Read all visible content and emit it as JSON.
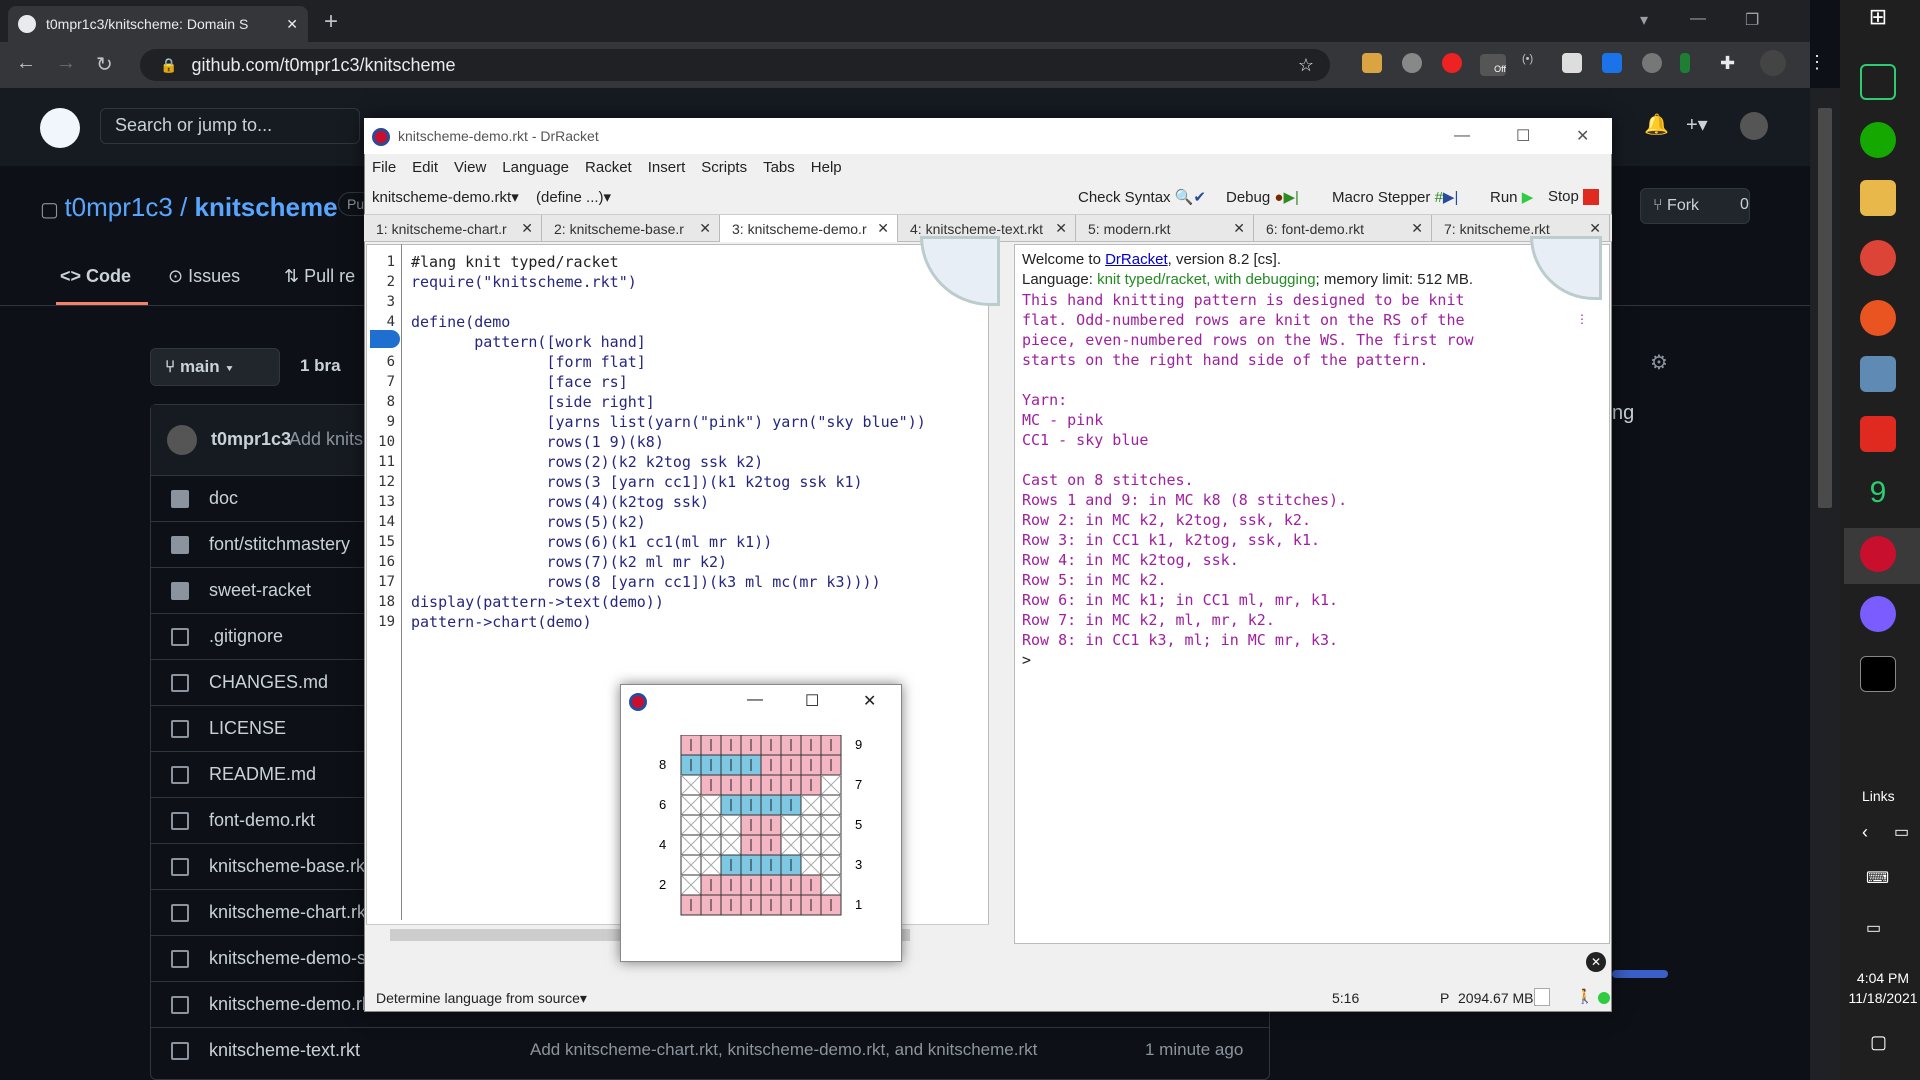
{
  "browser": {
    "tab_title": "t0mpr1c3/knitscheme: Domain S",
    "url": "github.com/t0mpr1c3/knitscheme",
    "ext_off_label": "Off"
  },
  "github": {
    "search_placeholder": "Search or jump to...",
    "owner": "t0mpr1c3",
    "repo": "knitscheme",
    "visibility": "Pu",
    "tabs": [
      "Code",
      "Issues",
      "Pull re"
    ],
    "branch": "main",
    "branches": "1 bra",
    "fork_label": "Fork",
    "fork_count": "0",
    "commit_user": "t0mpr1c3",
    "commit_msg": "Add knits",
    "side_text": "ng",
    "files": [
      {
        "name": "doc",
        "type": "dir"
      },
      {
        "name": "font/stitchmastery",
        "type": "dir"
      },
      {
        "name": "sweet-racket",
        "type": "submodule"
      },
      {
        "name": ".gitignore",
        "type": "file"
      },
      {
        "name": "CHANGES.md",
        "type": "file"
      },
      {
        "name": "LICENSE",
        "type": "file"
      },
      {
        "name": "README.md",
        "type": "file"
      },
      {
        "name": "font-demo.rkt",
        "type": "file"
      },
      {
        "name": "knitscheme-base.rkt",
        "type": "file"
      },
      {
        "name": "knitscheme-chart.rk",
        "type": "file"
      },
      {
        "name": "knitscheme-demo-s",
        "type": "file"
      },
      {
        "name": "knitscheme-demo.rk",
        "type": "file"
      },
      {
        "name": "knitscheme-text.rkt",
        "type": "file"
      }
    ],
    "last_commit_msg": "Add knitscheme-chart.rkt, knitscheme-demo.rkt, and knitscheme.rkt",
    "last_commit_time": "1 minute ago"
  },
  "drracket": {
    "title": "knitscheme-demo.rkt - DrRacket",
    "menu": [
      "File",
      "Edit",
      "View",
      "Language",
      "Racket",
      "Insert",
      "Scripts",
      "Tabs",
      "Help"
    ],
    "file_dropdown": "knitscheme-demo.rkt",
    "define_dropdown": "(define ...)",
    "toolbar": {
      "check_syntax": "Check Syntax",
      "debug": "Debug",
      "macro_stepper": "Macro Stepper",
      "run": "Run",
      "stop": "Stop"
    },
    "tabs": [
      "1: knitscheme-chart.r",
      "2: knitscheme-base.r",
      "3: knitscheme-demo.r",
      "4: knitscheme-text.rkt",
      "5: modern.rkt",
      "6: font-demo.rkt",
      "7: knitscheme.rkt"
    ],
    "code_lines": [
      "#lang knit typed/racket",
      "require(\"knitscheme.rkt\")",
      "",
      "define(demo",
      "       pattern([work hand]",
      "               [form flat]",
      "               [face rs]",
      "               [side right]",
      "               [yarns list(yarn(\"pink\") yarn(\"sky blue\"))",
      "               rows(1 9)(k8)",
      "               rows(2)(k2 k2tog ssk k2)",
      "               rows(3 [yarn cc1])(k1 k2tog ssk k1)",
      "               rows(4)(k2tog ssk)",
      "               rows(5)(k2)",
      "               rows(6)(k1 cc1(ml mr k1))",
      "               rows(7)(k2 ml mr k2)",
      "               rows(8 [yarn cc1])(k3 ml mc(mr k3))))",
      "display(pattern->text(demo))",
      "pattern->chart(demo)"
    ],
    "interactions": {
      "welcome": "Welcome to ",
      "welcome_link": "DrRacket",
      "welcome_rest": ", version 8.2 [cs].",
      "language_label": "Language: ",
      "language_value": "knit typed/racket, with debugging",
      "language_rest": "; memory limit: 512 MB.",
      "output": [
        "This hand knitting pattern is designed to be knit",
        "flat. Odd-numbered rows are knit on the RS of the",
        "piece, even-numbered rows on the WS. The first row",
        "starts on the right hand side of the pattern.",
        "",
        "Yarn:",
        "MC - pink",
        "CC1 - sky blue",
        "",
        "Cast on 8 stitches.",
        "Rows 1 and 9: in MC k8 (8 stitches).",
        "Row 2: in MC k2, k2tog, ssk, k2.",
        "Row 3: in CC1 k1, k2tog, ssk, k1.",
        "Row 4: in MC k2tog, ssk.",
        "Row 5: in MC k2.",
        "Row 6: in MC k1; in CC1 ml, mr, k1.",
        "Row 7: in MC k2, ml, mr, k2.",
        "Row 8: in CC1 k3, ml; in MC mr, k3.",
        ">"
      ]
    },
    "status": {
      "language": "Determine language from source",
      "position": "5:16",
      "mode": "P",
      "memory": "2094.67 MB"
    }
  },
  "chart_window": {
    "row_labels_left": [
      "8",
      "6",
      "4",
      "2"
    ],
    "row_labels_right": [
      "9",
      "7",
      "5",
      "3",
      "1"
    ]
  },
  "taskbar": {
    "links": "Links",
    "time": "4:04 PM",
    "date": "11/18/2021"
  },
  "colors": {
    "mc": "#f4b6c2",
    "cc1": "#7ec8e3",
    "noStitch": "#cccccc"
  }
}
